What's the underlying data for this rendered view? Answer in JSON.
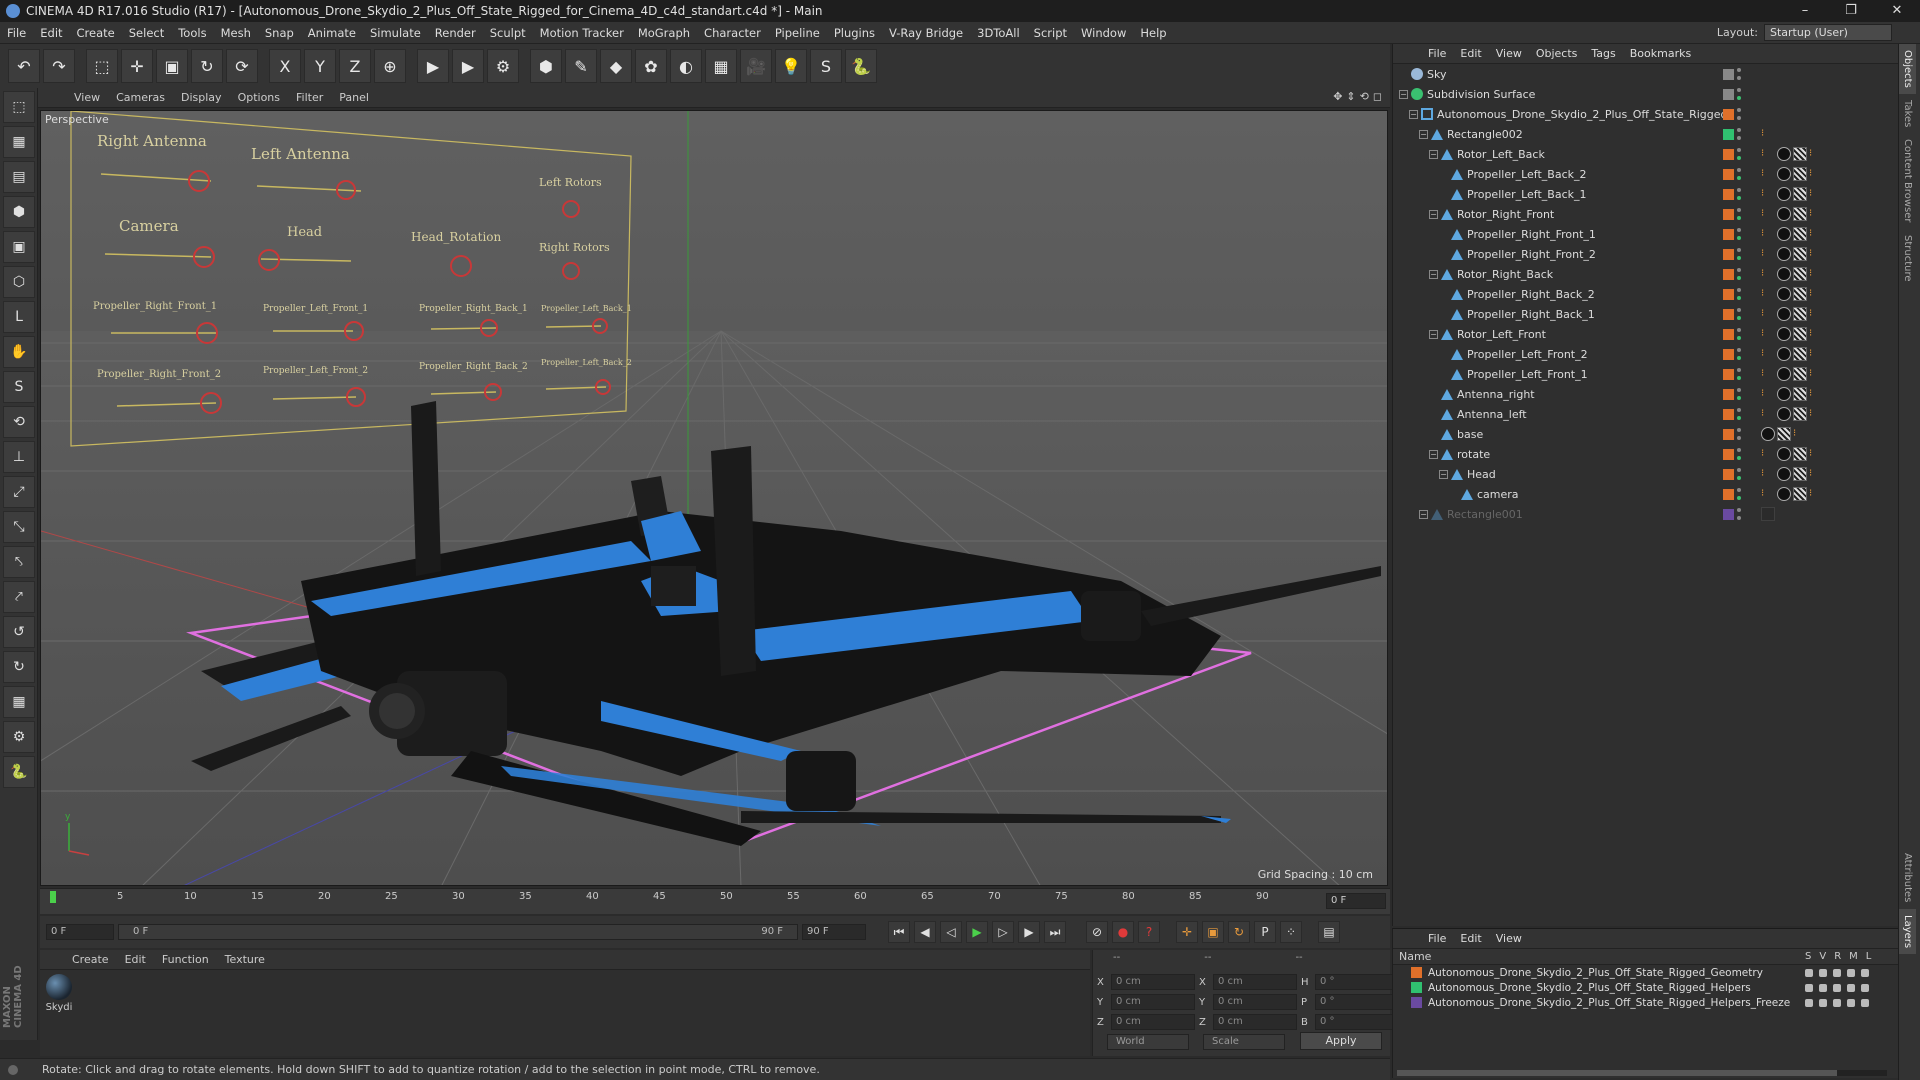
{
  "window": {
    "title": "CINEMA 4D R17.016 Studio (R17) - [Autonomous_Drone_Skydio_2_Plus_Off_State_Rigged_for_Cinema_4D_c4d_standart.c4d *] - Main",
    "controls": [
      "–",
      "❐",
      "✕"
    ]
  },
  "menu": [
    "File",
    "Edit",
    "Create",
    "Select",
    "Tools",
    "Mesh",
    "Snap",
    "Animate",
    "Simulate",
    "Render",
    "Sculpt",
    "Motion Tracker",
    "MoGraph",
    "Character",
    "Pipeline",
    "Plugins",
    "V-Ray Bridge",
    "3DToAll",
    "Script",
    "Window",
    "Help"
  ],
  "layout": {
    "label": "Layout:",
    "value": "Startup (User)"
  },
  "toolbar": [
    "undo-icon",
    "redo-icon",
    "select-icon",
    "move-icon",
    "scale-icon",
    "rotate-icon",
    "rotate-alt-icon",
    "x-axis-icon",
    "y-axis-icon",
    "z-axis-icon",
    "world-icon",
    "render-view-icon",
    "render-icon",
    "render-settings-icon",
    "cube-icon",
    "pen-icon",
    "subdivision-icon",
    "array-icon",
    "deformer-icon",
    "floor-icon",
    "camera-icon",
    "light-icon",
    "python-icon",
    "script-icon"
  ],
  "toolbar_glyphs": [
    "↶",
    "↷",
    "⬚",
    "✛",
    "▣",
    "↻",
    "⟳",
    "X",
    "Y",
    "Z",
    "⊕",
    "▶",
    "▶",
    "⚙",
    "⬢",
    "✎",
    "◆",
    "✿",
    "◐",
    "▦",
    "🎥",
    "💡",
    "S",
    "🐍"
  ],
  "left_tools": [
    "⬚",
    "▦",
    "▤",
    "⬢",
    "▣",
    "⬡",
    "L",
    "✋",
    "S",
    "⟲",
    "⊥",
    "⤢",
    "⤡",
    "⤣",
    "⤤",
    "↺",
    "↻",
    "▦",
    "⚙",
    "🐍"
  ],
  "viewport_menu": [
    "View",
    "Cameras",
    "Display",
    "Options",
    "Filter",
    "Panel"
  ],
  "viewport": {
    "label": "Perspective",
    "grid_spacing": "Grid Spacing : 10 cm"
  },
  "controller_labels": [
    "Right Antenna",
    "Left Antenna",
    "Left Rotors",
    "Camera",
    "Head",
    "Head_Rotation",
    "Right Rotors",
    "Propeller_Right_Front_1",
    "Propeller_Left_Front_1",
    "Propeller_Right_Back_1",
    "Propeller_Left_Back_1",
    "Propeller_Right_Front_2",
    "Propeller_Left_Front_2",
    "Propeller_Right_Back_2",
    "Propeller_Left_Back_2"
  ],
  "timeline": {
    "ticks": [
      "0",
      "5",
      "10",
      "15",
      "20",
      "25",
      "30",
      "35",
      "40",
      "45",
      "50",
      "55",
      "60",
      "65",
      "70",
      "75",
      "80",
      "85",
      "90"
    ],
    "frame_display": "0 F"
  },
  "playback": {
    "start": "0 F",
    "range_start": "0 F",
    "range_end": "90 F",
    "end": "90 F"
  },
  "material_menu": [
    "Create",
    "Edit",
    "Function",
    "Texture"
  ],
  "materials": [
    {
      "name": "Skydi"
    }
  ],
  "coords": {
    "headers": [
      "--",
      "--",
      "--"
    ],
    "rows": [
      {
        "a": "X",
        "v1": "0 cm",
        "b": "X",
        "v2": "0 cm",
        "c": "H",
        "v3": "0 °"
      },
      {
        "a": "Y",
        "v1": "0 cm",
        "b": "Y",
        "v2": "0 cm",
        "c": "P",
        "v3": "0 °"
      },
      {
        "a": "Z",
        "v1": "0 cm",
        "b": "Z",
        "v2": "0 cm",
        "c": "B",
        "v3": "0 °"
      }
    ],
    "mode": "World",
    "transform": "Scale",
    "apply": "Apply"
  },
  "status": "Rotate: Click and drag to rotate elements. Hold down SHIFT to add to quantize rotation / add to the selection in point mode, CTRL to remove.",
  "object_menu": [
    "File",
    "Edit",
    "View",
    "Objects",
    "Tags",
    "Bookmarks"
  ],
  "objects": [
    {
      "name": "Sky",
      "depth": 0,
      "color": "#888888",
      "type": "sky",
      "tags": false
    },
    {
      "name": "Subdivision Surface",
      "depth": 0,
      "color": "#888888",
      "type": "subdiv",
      "tags": false
    },
    {
      "name": "Autonomous_Drone_Skydio_2_Plus_Off_State_Rigged",
      "depth": 1,
      "color": "#e0702a",
      "type": "null",
      "tags": false
    },
    {
      "name": "Rectangle002",
      "depth": 2,
      "color": "#30c070",
      "type": "joint",
      "tags": "dots"
    },
    {
      "name": "Rotor_Left_Back",
      "depth": 3,
      "color": "#e0702a",
      "type": "joint",
      "tags": true
    },
    {
      "name": "Propeller_Left_Back_2",
      "depth": 4,
      "color": "#e0702a",
      "type": "joint",
      "tags": true
    },
    {
      "name": "Propeller_Left_Back_1",
      "depth": 4,
      "color": "#e0702a",
      "type": "joint",
      "tags": true
    },
    {
      "name": "Rotor_Right_Front",
      "depth": 3,
      "color": "#e0702a",
      "type": "joint",
      "tags": true
    },
    {
      "name": "Propeller_Right_Front_1",
      "depth": 4,
      "color": "#e0702a",
      "type": "joint",
      "tags": true
    },
    {
      "name": "Propeller_Right_Front_2",
      "depth": 4,
      "color": "#e0702a",
      "type": "joint",
      "tags": true
    },
    {
      "name": "Rotor_Right_Back",
      "depth": 3,
      "color": "#e0702a",
      "type": "joint",
      "tags": true
    },
    {
      "name": "Propeller_Right_Back_2",
      "depth": 4,
      "color": "#e0702a",
      "type": "joint",
      "tags": true
    },
    {
      "name": "Propeller_Right_Back_1",
      "depth": 4,
      "color": "#e0702a",
      "type": "joint",
      "tags": true
    },
    {
      "name": "Rotor_Left_Front",
      "depth": 3,
      "color": "#e0702a",
      "type": "joint",
      "tags": true
    },
    {
      "name": "Propeller_Left_Front_2",
      "depth": 4,
      "color": "#e0702a",
      "type": "joint",
      "tags": true
    },
    {
      "name": "Propeller_Left_Front_1",
      "depth": 4,
      "color": "#e0702a",
      "type": "joint",
      "tags": true
    },
    {
      "name": "Antenna_right",
      "depth": 3,
      "color": "#e0702a",
      "type": "joint",
      "tags": true
    },
    {
      "name": "Antenna_left",
      "depth": 3,
      "color": "#e0702a",
      "type": "joint",
      "tags": true
    },
    {
      "name": "base",
      "depth": 3,
      "color": "#e0702a",
      "type": "joint",
      "tags": "base"
    },
    {
      "name": "rotate",
      "depth": 3,
      "color": "#e0702a",
      "type": "joint",
      "tags": true
    },
    {
      "name": "Head",
      "depth": 4,
      "color": "#e0702a",
      "type": "joint",
      "tags": true
    },
    {
      "name": "camera",
      "depth": 5,
      "color": "#e0702a",
      "type": "joint",
      "tags": true
    },
    {
      "name": "Rectangle001",
      "depth": 2,
      "color": "#6a4aa0",
      "type": "joint",
      "tags": "dim",
      "dim": true
    }
  ],
  "layer_menu": [
    "File",
    "Edit",
    "View"
  ],
  "layer_header": {
    "name": "Name",
    "cols": [
      "S",
      "V",
      "R",
      "M",
      "L"
    ]
  },
  "layers": [
    {
      "name": "Autonomous_Drone_Skydio_2_Plus_Off_State_Rigged_Geometry",
      "color": "#e0702a"
    },
    {
      "name": "Autonomous_Drone_Skydio_2_Plus_Off_State_Rigged_Helpers",
      "color": "#30c070"
    },
    {
      "name": "Autonomous_Drone_Skydio_2_Plus_Off_State_Rigged_Helpers_Freeze",
      "color": "#6a4aa0"
    }
  ],
  "right_tabs": [
    "Objects",
    "Takes",
    "Content Browser",
    "Structure",
    "Attributes",
    "Layers"
  ],
  "colors": {
    "accent_blue": "#2f7fd6",
    "selection_pink": "#e070e0",
    "axis_green": "#3a9a3a"
  }
}
